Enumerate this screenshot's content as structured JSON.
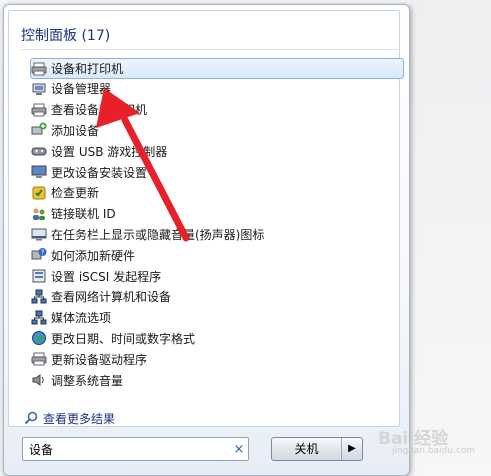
{
  "group": {
    "title": "控制面板 (17)"
  },
  "items": [
    {
      "label": "设备和打印机",
      "icon": "printer-icon",
      "selected": true
    },
    {
      "label": "设备管理器",
      "icon": "device-manager-icon"
    },
    {
      "label": "查看设备和打印机",
      "icon": "printer-icon"
    },
    {
      "label": "添加设备",
      "icon": "add-device-icon"
    },
    {
      "label": "设置 USB 游戏控制器",
      "icon": "gamepad-icon"
    },
    {
      "label": "更改设备安装设置",
      "icon": "computer-icon"
    },
    {
      "label": "检查更新",
      "icon": "update-icon"
    },
    {
      "label": "链接联机 ID",
      "icon": "users-icon"
    },
    {
      "label": "在任务栏上显示或隐藏音量(扬声器)图标",
      "icon": "taskbar-icon"
    },
    {
      "label": "如何添加新硬件",
      "icon": "help-icon"
    },
    {
      "label": "设置 iSCSI 发起程序",
      "icon": "iscsi-icon"
    },
    {
      "label": "查看网络计算机和设备",
      "icon": "network-icon"
    },
    {
      "label": "媒体流选项",
      "icon": "network-icon"
    },
    {
      "label": "更改日期、时间或数字格式",
      "icon": "globe-icon"
    },
    {
      "label": "更新设备驱动程序",
      "icon": "printer-icon"
    },
    {
      "label": "调整系统音量",
      "icon": "speaker-icon"
    }
  ],
  "more_results": "查看更多结果",
  "search": {
    "value": "设备",
    "clear": "×"
  },
  "shutdown": {
    "label": "关机",
    "arrow": "▶"
  },
  "watermark": {
    "text": "Bai 经验",
    "sub": "jingyan.baidu.com"
  },
  "colors": {
    "annotation_arrow": "#e8202a",
    "link": "#1e3287",
    "selection": "#d9e8fb"
  }
}
